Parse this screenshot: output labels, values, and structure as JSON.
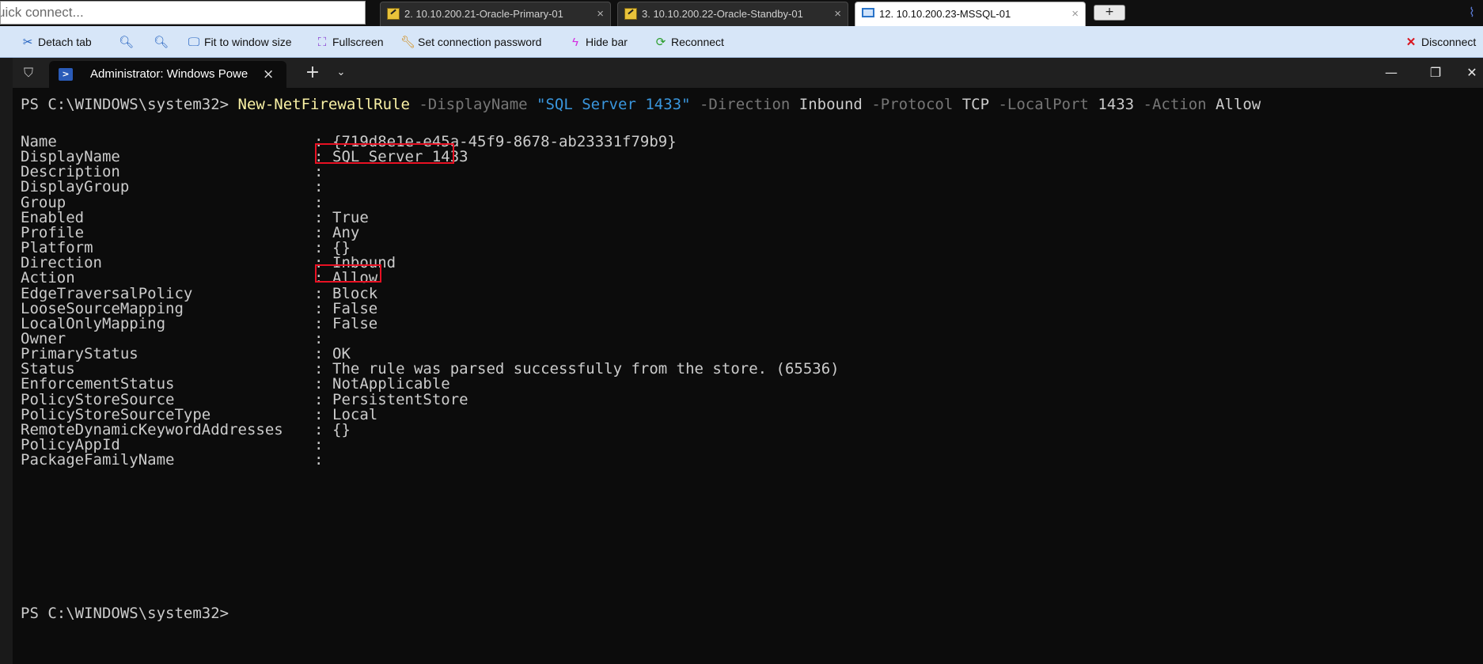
{
  "top_bar": {
    "quick_connect_placeholder": "uick connect...",
    "tabs": [
      {
        "label": "2. 10.10.200.21-Oracle-Primary-01",
        "icon": "key-icon",
        "close": "×"
      },
      {
        "label": "3. 10.10.200.22-Oracle-Standby-01",
        "icon": "key-icon",
        "close": "×"
      },
      {
        "label": "12. 10.10.200.23-MSSQL-01",
        "icon": "monitor-icon",
        "close": "×",
        "active": true
      }
    ],
    "new_tab": "+"
  },
  "toolbar": {
    "detach_tab": "Detach tab",
    "zoom_in": "",
    "zoom_out": "",
    "fit_to_window": "Fit to window size",
    "fullscreen": "Fullscreen",
    "set_connection_password": "Set connection password",
    "hide_bar": "Hide bar",
    "reconnect": "Reconnect",
    "disconnect": "Disconnect"
  },
  "terminal_window": {
    "tab_title": "Administrator: Windows Powe",
    "tab_close": "×",
    "new_tab": "+",
    "dropdown": "⌄",
    "minimize": "—",
    "maximize": "❐",
    "close": "✕"
  },
  "terminal": {
    "prompt": "PS C:\\WINDOWS\\system32> ",
    "command": {
      "cmdlet": "New-NetFirewallRule",
      "p1": " -DisplayName",
      "v1": " \"SQL Server 1433\"",
      "p2": " -Direction",
      "v2": " Inbound",
      "p3": " -Protocol",
      "v3": " TCP",
      "p4": " -LocalPort",
      "v4": " 1433",
      "p5": " -Action",
      "v5": " Allow"
    },
    "separator": ":",
    "properties": [
      {
        "key": "Name",
        "value": "{719d8e1e-e45a-45f9-8678-ab23331f79b9}"
      },
      {
        "key": "DisplayName",
        "value": "SQL Server 1433"
      },
      {
        "key": "Description",
        "value": ""
      },
      {
        "key": "DisplayGroup",
        "value": ""
      },
      {
        "key": "Group",
        "value": ""
      },
      {
        "key": "Enabled",
        "value": "True"
      },
      {
        "key": "Profile",
        "value": "Any"
      },
      {
        "key": "Platform",
        "value": "{}"
      },
      {
        "key": "Direction",
        "value": "Inbound"
      },
      {
        "key": "Action",
        "value": "Allow"
      },
      {
        "key": "EdgeTraversalPolicy",
        "value": "Block"
      },
      {
        "key": "LooseSourceMapping",
        "value": "False"
      },
      {
        "key": "LocalOnlyMapping",
        "value": "False"
      },
      {
        "key": "Owner",
        "value": ""
      },
      {
        "key": "PrimaryStatus",
        "value": "OK"
      },
      {
        "key": "Status",
        "value": "The rule was parsed successfully from the store. (65536)"
      },
      {
        "key": "EnforcementStatus",
        "value": "NotApplicable"
      },
      {
        "key": "PolicyStoreSource",
        "value": "PersistentStore"
      },
      {
        "key": "PolicyStoreSourceType",
        "value": "Local"
      },
      {
        "key": "RemoteDynamicKeywordAddresses",
        "value": "{}"
      },
      {
        "key": "PolicyAppId",
        "value": ""
      },
      {
        "key": "PackageFamilyName",
        "value": ""
      }
    ],
    "final_prompt": "PS C:\\WINDOWS\\system32>"
  },
  "colors": {
    "highlight_box": "#e81123",
    "cmdlet": "#f9f1a5",
    "parameter": "#767676",
    "string": "#3a96dd",
    "text": "#cccccc",
    "toolbar_bg": "#d7e6f8"
  }
}
